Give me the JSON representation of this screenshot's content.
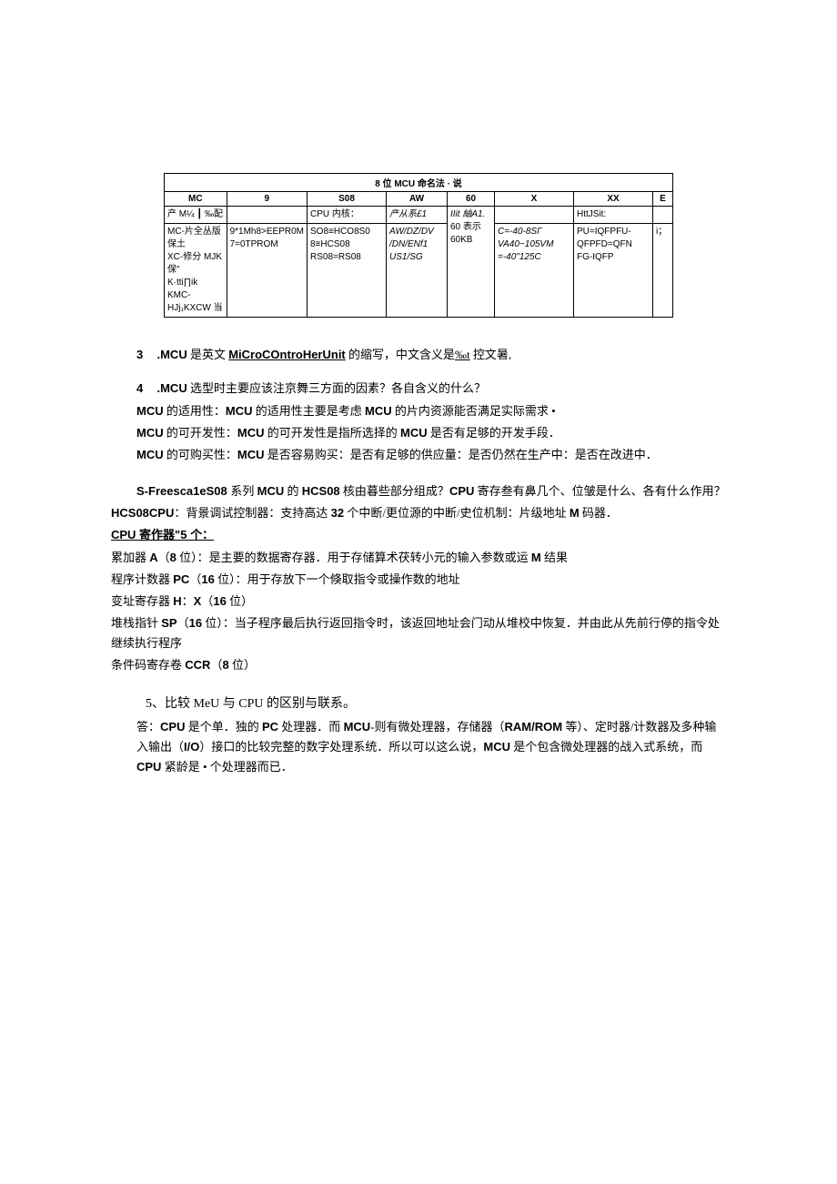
{
  "table": {
    "title": "8 位 MCU 命名法 · 说",
    "head": [
      "MC",
      "9",
      "S08",
      "AW",
      "60",
      "X",
      "XX",
      "E"
    ],
    "row1": [
      "产 M¼ ┃ ‰配",
      "",
      "CPU 内核：",
      "产从系£1",
      "IIit 紬A1.",
      "",
      "HttJSit:",
      ""
    ],
    "row2": [
      "MC-片全丛版保土\nXC-修分 MJK 保\"\nK·tti∏ik\nKMC-\nHJj₁KXCW 当",
      "9*1Mh8>EEPR0M\n7=0TPROM",
      "SO8≡HCO8S0\n8≡HCS08\nRS08=RS08",
      "AW/DZ/DV\n/DN/ENf1\nUS1/SG",
      "60 表示\n60KB",
      "C=-40-8SГ\nVA40~105VM\n=-40\"125C",
      "PU=IQFPFU-QFPFD=QFN\nFG-IQFP",
      "i；"
    ]
  },
  "q3": {
    "num": "3",
    "prefix": ".MCU",
    "t1": " 是英文 ",
    "u1": "MiCroCOntroHerUnit",
    "t2": " 的缩写，中文含义是",
    "u2": "‰t",
    "t3": " 控文暑,"
  },
  "q4": {
    "num": "4",
    "prefix": ".MCU",
    "title": " 选型时主要应该注京舞三方面的因素？各自含义的什么？",
    "a1a": "MCU",
    "a1b": " 的适用性：",
    "a1c": "MCU",
    "a1d": " 的适用性主要是考虑 ",
    "a1e": "MCU",
    "a1f": " 的片内资源能否满足实际需求 •",
    "a2a": "MCU",
    "a2b": " 的可开发性：",
    "a2c": "MCU",
    "a2d": " 的可开发性是指所选择的 ",
    "a2e": "MCU",
    "a2f": " 是否有足够的开发手段．",
    "a3a": "MCU",
    "a3b": " 的可购买性：",
    "a3c": "MCU",
    "a3d": " 是否容易购买：是否有足够的供应量：是否仍然在生产中：是否在改进中．"
  },
  "q5pre": {
    "t1": "S-Freesca1eS08 ",
    "t2": "系列 ",
    "t3": "MCU",
    "t4": " 的 ",
    "t5": "HCS08",
    "t6": " 核由暮些部分组成？",
    "t7": "CPU",
    "t8": " 寄存叁有鼻几个、位皱是什么、各有什么作用？"
  },
  "hcs": {
    "b1": "HCS08CPU",
    "t1": "：背景调试控制器：支持高达 ",
    "b2": "32",
    "t2": " 个中断/更位源的中断/史位机制：片级地址 ",
    "b3": "M",
    "t3": " 码器．",
    "u1": "CPU 寄作器\"5 个：",
    "r1a": "累加器 ",
    "r1b": "A",
    "r1c": "（",
    "r1d": "8",
    "r1e": " 位）：是主要的数据寄存器．用于存储算术茯转小元的输入参数或运 ",
    "r1f": "M",
    "r1g": " 结果",
    "r2a": "程序计数器 ",
    "r2b": "PC",
    "r2c": "（",
    "r2d": "16",
    "r2e": " 位）：用于存放下一个倏取指令或操作数的地址",
    "r3a": "变址寄存器 ",
    "r3b": "H",
    "r3c": "：",
    "r3d": "X",
    "r3e": "（",
    "r3f": "16",
    "r3g": " 位）",
    "r4a": "堆栈指针 ",
    "r4b": "SP",
    "r4c": "（",
    "r4d": "16",
    "r4e": " 位）：当子程序最后执行返回指令时，该返回地址会门动从堆校中恢复．并由此从先前行停的指令处继续执行程序",
    "r5a": "条件码寄存卷 ",
    "r5b": "CCR",
    "r5c": "（",
    "r5d": "8",
    "r5e": " 位）"
  },
  "q5": {
    "title": "5、比较 MeU 与 CPU 的区别与联系。",
    "t0": "答：",
    "b1": "CPU",
    "t1": " 是个单．独的 ",
    "b2": "PC",
    "t2": " 处理器．而 ",
    "b3": "MCU",
    "t3": "-则有微处理器，存储器（",
    "b4": "RAM/ROM",
    "t4": " 等）、定时器/计数器及多种输入输出（",
    "b5": "I/O",
    "t5": "）接口的比较完整的数字处理系统．所以可以这么说，",
    "b6": "MCU",
    "t6": " 是个包含微处理器的战入式系统，而 ",
    "b7": "CPU",
    "t7": " 紧龄是 • 个处理器而已．"
  }
}
